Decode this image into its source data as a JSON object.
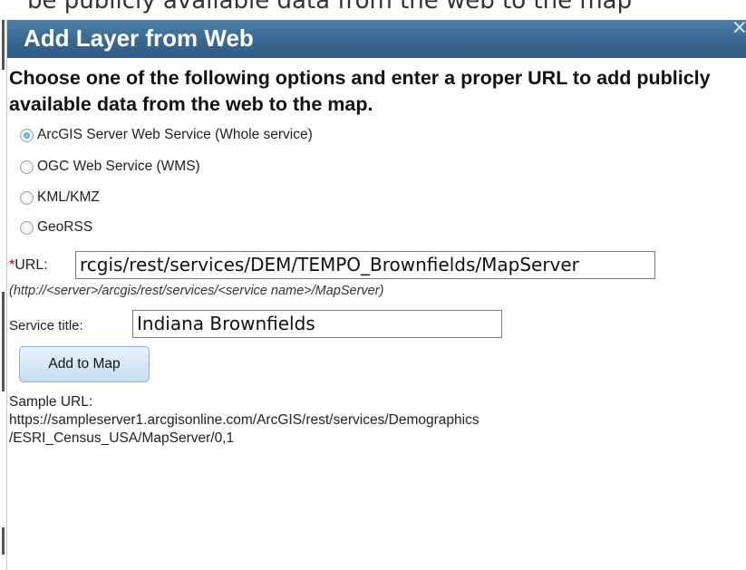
{
  "window_fragment": "be publicly available data from the web to the map",
  "dialog": {
    "title": "Add Layer from Web",
    "close_glyph": "×",
    "instructions": "Choose one of the following options and enter a proper URL to add publicly available data from the web to the map.",
    "options": [
      {
        "label": "ArcGIS Server Web Service (Whole service)",
        "checked": true
      },
      {
        "label": "OGC Web Service (WMS)",
        "checked": false
      },
      {
        "label": "KML/KMZ",
        "checked": false
      },
      {
        "label": "GeoRSS",
        "checked": false
      }
    ],
    "url_required_mark": "*",
    "url_label": "URL:",
    "url_value": "rcgis/rest/services/DEM/TEMPO_Brownfields/MapServer",
    "url_hint": "(http://<server>/arcgis/rest/services/<service name>/MapServer)",
    "service_title_label": "Service title:",
    "service_title_value": "Indiana Brownfields",
    "add_button_label": "Add to Map",
    "sample_label": "Sample URL:",
    "sample_url_line1": "https://sampleserver1.arcgisonline.com/ArcGIS/rest/services/Demographics",
    "sample_url_line2": "/ESRI_Census_USA/MapServer/0,1"
  }
}
